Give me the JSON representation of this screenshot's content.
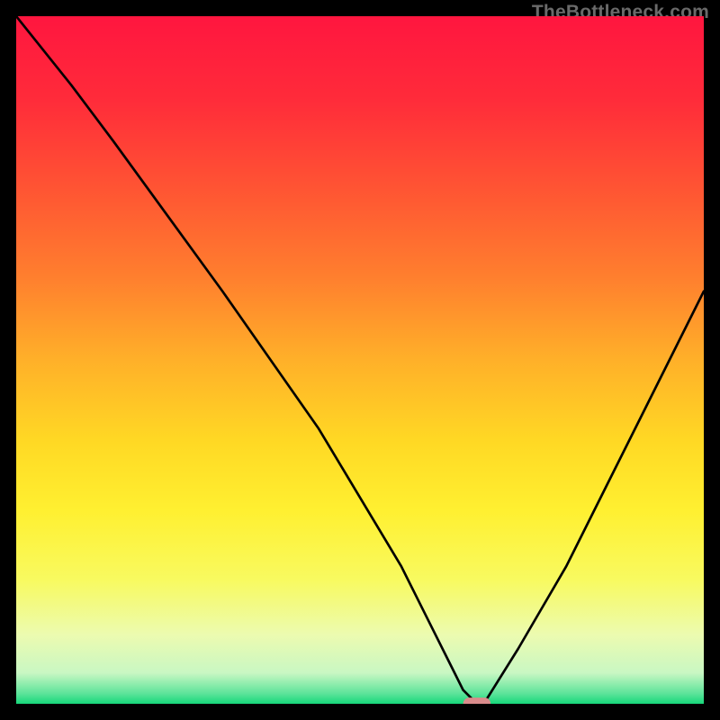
{
  "watermark": "TheBottleneck.com",
  "chart_data": {
    "type": "line",
    "title": "",
    "xlabel": "",
    "ylabel": "",
    "xlim": [
      0,
      100
    ],
    "ylim": [
      0,
      100
    ],
    "series": [
      {
        "name": "curve",
        "x": [
          0,
          8,
          14,
          22,
          30,
          37,
          44,
          50,
          56,
          60,
          63,
          65,
          67,
          68,
          73,
          80,
          86,
          92,
          96,
          100
        ],
        "y": [
          100,
          90,
          82,
          71,
          60,
          50,
          40,
          30,
          20,
          12,
          6,
          2,
          0,
          0,
          8,
          20,
          32,
          44,
          52,
          60
        ]
      }
    ],
    "marker": {
      "x": 67,
      "y": 0,
      "color": "#d98b8b"
    },
    "background_gradient": {
      "stops": [
        {
          "pos": 0.0,
          "color": "#ff163f"
        },
        {
          "pos": 0.12,
          "color": "#ff2b3a"
        },
        {
          "pos": 0.25,
          "color": "#ff5433"
        },
        {
          "pos": 0.38,
          "color": "#ff7f2e"
        },
        {
          "pos": 0.5,
          "color": "#ffb029"
        },
        {
          "pos": 0.62,
          "color": "#ffd924"
        },
        {
          "pos": 0.72,
          "color": "#fff031"
        },
        {
          "pos": 0.82,
          "color": "#f8fa60"
        },
        {
          "pos": 0.9,
          "color": "#ecfbb0"
        },
        {
          "pos": 0.955,
          "color": "#c9f7c3"
        },
        {
          "pos": 0.985,
          "color": "#5de39a"
        },
        {
          "pos": 1.0,
          "color": "#16d77a"
        }
      ]
    }
  }
}
